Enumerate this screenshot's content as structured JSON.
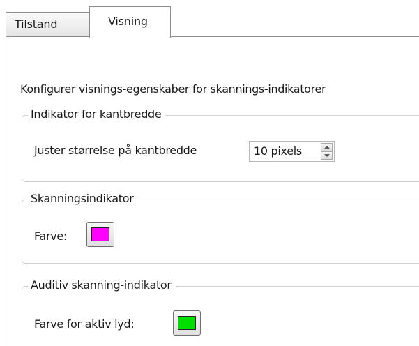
{
  "tabs": [
    {
      "label": "Tilstand",
      "active": false
    },
    {
      "label": "Visning",
      "active": true
    }
  ],
  "panel": {
    "description": "Konfigurer visnings-egenskaber for skannings-indikatorer"
  },
  "groups": {
    "border_width": {
      "title": "Indikator for kantbredde",
      "label": "Juster størrelse på kantbredde",
      "spinner_value": "10 pixels"
    },
    "scan_indicator": {
      "title": "Skanningsindikator",
      "label": "Farve:",
      "color": "#ff00ff"
    },
    "auditory_indicator": {
      "title": "Auditiv skanning-indikator",
      "label": "Farve for aktiv lyd:",
      "color": "#00dd00"
    }
  }
}
